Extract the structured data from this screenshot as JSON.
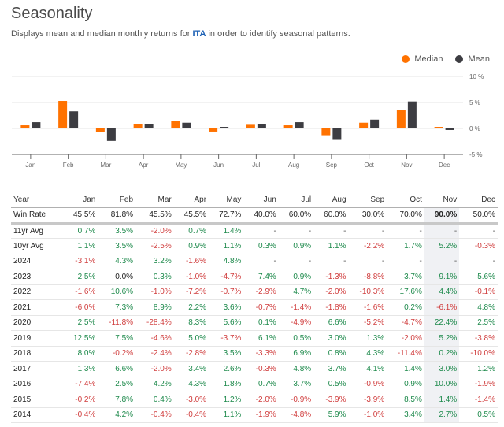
{
  "header": {
    "title": "Seasonality",
    "subtitle_prefix": "Displays mean and median monthly returns for ",
    "ticker": "ITA",
    "subtitle_suffix": " in order to identify seasonal patterns."
  },
  "legend": [
    {
      "label": "Median",
      "color": "#ff7200",
      "icon": "circle-icon"
    },
    {
      "label": "Mean",
      "color": "#3d3d42",
      "icon": "circle-icon"
    }
  ],
  "chart_data": {
    "type": "bar",
    "title": "",
    "xlabel": "",
    "ylabel": "",
    "categories": [
      "Jan",
      "Feb",
      "Mar",
      "Apr",
      "May",
      "Jun",
      "Jul",
      "Aug",
      "Sep",
      "Oct",
      "Nov",
      "Dec"
    ],
    "series": [
      {
        "name": "Median",
        "color": "#ff7200",
        "values": [
          0.6,
          5.3,
          -0.7,
          0.9,
          1.5,
          -0.6,
          0.7,
          0.6,
          -1.3,
          1.1,
          3.6,
          0.3
        ]
      },
      {
        "name": "Mean",
        "color": "#3d3d42",
        "values": [
          1.2,
          3.3,
          -2.4,
          0.9,
          1.1,
          0.3,
          0.9,
          1.2,
          -2.2,
          1.7,
          5.2,
          -0.3
        ]
      }
    ],
    "yticks": [
      "10 %",
      "5 %",
      "0 %",
      "-5 %"
    ],
    "ytick_values": [
      10,
      5,
      0,
      -5
    ],
    "ylim": [
      -5,
      10
    ],
    "grid": true,
    "legend_position": "top-right"
  },
  "table": {
    "headers": [
      "Year",
      "Jan",
      "Feb",
      "Mar",
      "Apr",
      "May",
      "Jun",
      "Jul",
      "Aug",
      "Sep",
      "Oct",
      "Nov",
      "Dec"
    ],
    "highlight_column": "Nov",
    "win_rate": {
      "label": "Win Rate",
      "values": [
        "45.5%",
        "81.8%",
        "45.5%",
        "45.5%",
        "72.7%",
        "40.0%",
        "60.0%",
        "60.0%",
        "30.0%",
        "70.0%",
        "90.0%",
        "50.0%"
      ]
    },
    "rows": [
      {
        "label": "11yr Avg",
        "values": [
          "0.7%",
          "3.5%",
          "-2.0%",
          "0.7%",
          "1.4%",
          "-",
          "-",
          "-",
          "-",
          "-",
          "-",
          "-"
        ]
      },
      {
        "label": "10yr Avg",
        "values": [
          "1.1%",
          "3.5%",
          "-2.5%",
          "0.9%",
          "1.1%",
          "0.3%",
          "0.9%",
          "1.1%",
          "-2.2%",
          "1.7%",
          "5.2%",
          "-0.3%"
        ]
      },
      {
        "label": "2024",
        "values": [
          "-3.1%",
          "4.3%",
          "3.2%",
          "-1.6%",
          "4.8%",
          "-",
          "-",
          "-",
          "-",
          "-",
          "-",
          "-"
        ]
      },
      {
        "label": "2023",
        "values": [
          "2.5%",
          "0.0%",
          "0.3%",
          "-1.0%",
          "-4.7%",
          "7.4%",
          "0.9%",
          "-1.3%",
          "-8.8%",
          "3.7%",
          "9.1%",
          "5.6%"
        ]
      },
      {
        "label": "2022",
        "values": [
          "-1.6%",
          "10.6%",
          "-1.0%",
          "-7.2%",
          "-0.7%",
          "-2.9%",
          "4.7%",
          "-2.0%",
          "-10.3%",
          "17.6%",
          "4.4%",
          "-0.1%"
        ]
      },
      {
        "label": "2021",
        "values": [
          "-6.0%",
          "7.3%",
          "8.9%",
          "2.2%",
          "3.6%",
          "-0.7%",
          "-1.4%",
          "-1.8%",
          "-1.6%",
          "0.2%",
          "-6.1%",
          "4.8%"
        ]
      },
      {
        "label": "2020",
        "values": [
          "2.5%",
          "-11.8%",
          "-28.4%",
          "8.3%",
          "5.6%",
          "0.1%",
          "-4.9%",
          "6.6%",
          "-5.2%",
          "-4.7%",
          "22.4%",
          "2.5%"
        ]
      },
      {
        "label": "2019",
        "values": [
          "12.5%",
          "7.5%",
          "-4.6%",
          "5.0%",
          "-3.7%",
          "6.1%",
          "0.5%",
          "3.0%",
          "1.3%",
          "-2.0%",
          "5.2%",
          "-3.8%"
        ]
      },
      {
        "label": "2018",
        "values": [
          "8.0%",
          "-0.2%",
          "-2.4%",
          "-2.8%",
          "3.5%",
          "-3.3%",
          "6.9%",
          "0.8%",
          "4.3%",
          "-11.4%",
          "0.2%",
          "-10.0%"
        ]
      },
      {
        "label": "2017",
        "values": [
          "1.3%",
          "6.6%",
          "-2.0%",
          "3.4%",
          "2.6%",
          "-0.3%",
          "4.8%",
          "3.7%",
          "4.1%",
          "1.4%",
          "3.0%",
          "1.2%"
        ]
      },
      {
        "label": "2016",
        "values": [
          "-7.4%",
          "2.5%",
          "4.2%",
          "4.3%",
          "1.8%",
          "0.7%",
          "3.7%",
          "0.5%",
          "-0.9%",
          "0.9%",
          "10.0%",
          "-1.9%"
        ]
      },
      {
        "label": "2015",
        "values": [
          "-0.2%",
          "7.8%",
          "0.4%",
          "-3.0%",
          "1.2%",
          "-2.0%",
          "-0.9%",
          "-3.9%",
          "-3.9%",
          "8.5%",
          "1.4%",
          "-1.4%"
        ]
      },
      {
        "label": "2014",
        "values": [
          "-0.4%",
          "4.2%",
          "-0.4%",
          "-0.4%",
          "1.1%",
          "-1.9%",
          "-4.8%",
          "5.9%",
          "-1.0%",
          "3.4%",
          "2.7%",
          "0.5%"
        ]
      }
    ]
  }
}
